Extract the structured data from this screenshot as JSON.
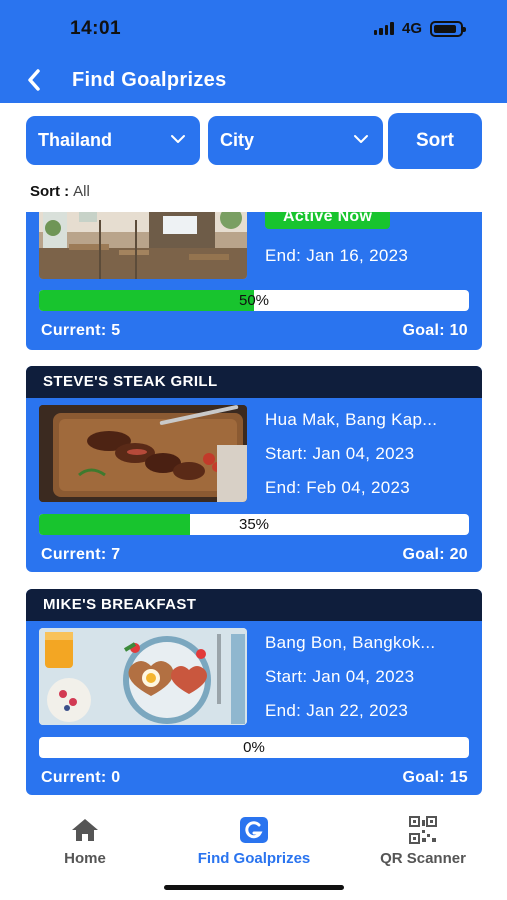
{
  "status_bar": {
    "time": "14:01",
    "network": "4G"
  },
  "nav": {
    "title": "Find Goalprizes"
  },
  "filters": {
    "country": "Thailand",
    "city": "City",
    "sort_button": "Sort"
  },
  "sort": {
    "label": "Sort :",
    "value": "All"
  },
  "cards": [
    {
      "badge": "Active Now",
      "end": "End: Jan 16, 2023",
      "progress_percent": 50,
      "progress_label": "50%",
      "current": "Current: 5",
      "goal": "Goal: 10"
    },
    {
      "title": "STEVE'S STEAK GRILL",
      "location": "Hua Mak, Bang Kap...",
      "start": "Start: Jan 04, 2023",
      "end": "End: Feb 04, 2023",
      "progress_percent": 35,
      "progress_label": "35%",
      "current": "Current: 7",
      "goal": "Goal: 20"
    },
    {
      "title": "MIKE'S BREAKFAST",
      "location": "Bang Bon, Bangkok...",
      "start": "Start: Jan 04, 2023",
      "end": "End: Jan 22, 2023",
      "progress_percent": 0,
      "progress_label": "0%",
      "current": "Current: 0",
      "goal": "Goal: 15"
    }
  ],
  "tabbar": {
    "home": "Home",
    "find": "Find Goalprizes",
    "qr": "QR Scanner"
  },
  "colors": {
    "primary": "#2a74ef",
    "dark": "#0f1e3c",
    "success": "#18c42e"
  },
  "icons": [
    "back-chevron-icon",
    "chevron-down-icon",
    "home-icon",
    "goalprizes-logo-icon",
    "qr-code-icon"
  ]
}
